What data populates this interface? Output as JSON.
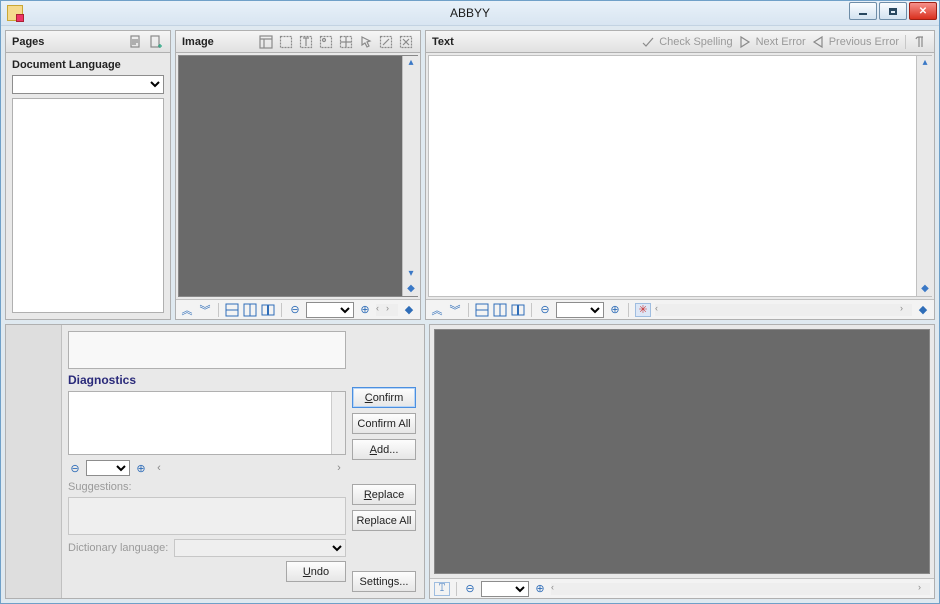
{
  "window": {
    "title": "ABBYY"
  },
  "pages": {
    "title": "Pages",
    "document_language_label": "Document Language",
    "language_value": ""
  },
  "image": {
    "title": "Image",
    "zoom_value": ""
  },
  "text": {
    "title": "Text",
    "check_spelling": "Check Spelling",
    "next_error": "Next Error",
    "previous_error": "Previous Error",
    "zoom_value": ""
  },
  "diagnostics": {
    "title": "Diagnostics",
    "zoom_value": "",
    "suggestions_label": "Suggestions:",
    "dictionary_language_label": "Dictionary language:",
    "dictionary_language_value": "",
    "buttons": {
      "confirm": "Confirm",
      "confirm_all": "Confirm All",
      "add": "Add...",
      "replace": "Replace",
      "replace_all": "Replace All",
      "undo": "Undo",
      "settings": "Settings..."
    }
  },
  "preview": {
    "zoom_value": ""
  }
}
